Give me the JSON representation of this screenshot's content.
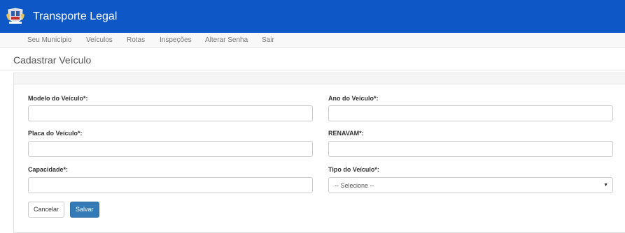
{
  "header": {
    "app_title": "Transporte Legal",
    "logo_icon": "coat-of-arms-icon",
    "background_color": "#0e57c6"
  },
  "nav": {
    "items": [
      {
        "label": "Seu Município"
      },
      {
        "label": "Veículos"
      },
      {
        "label": "Rotas"
      },
      {
        "label": "Inspeções"
      },
      {
        "label": "Alterar Senha"
      },
      {
        "label": "Sair"
      }
    ]
  },
  "page": {
    "title": "Cadastrar Veículo"
  },
  "form": {
    "modelo_label": "Modelo do Veículo*:",
    "modelo_value": "",
    "ano_label": "Ano do Veículo*:",
    "ano_value": "",
    "placa_label": "Placa do Veículo*:",
    "placa_value": "",
    "renavam_label": "RENAVAM*:",
    "renavam_value": "",
    "capacidade_label": "Capacidade*:",
    "capacidade_value": "",
    "tipo_label": "Tipo do Veículo*:",
    "tipo_selected": "-- Selecione --",
    "cancel_label": "Cancelar",
    "save_label": "Salvar",
    "primary_color": "#337ab7"
  }
}
